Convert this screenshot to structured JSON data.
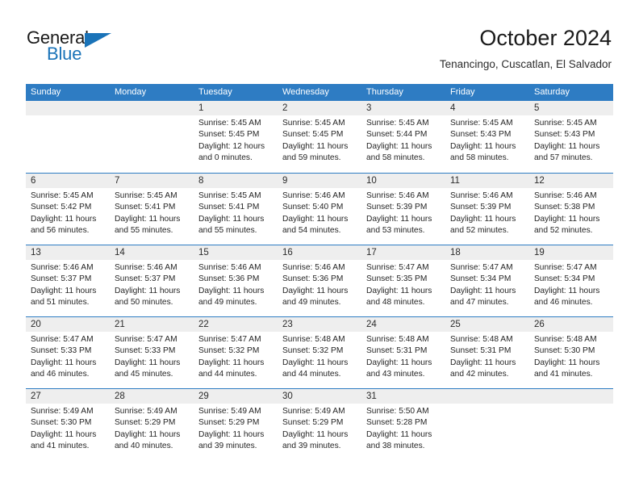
{
  "brand": {
    "word1": "General",
    "word2": "Blue",
    "logo_icon": "triangle-icon"
  },
  "header": {
    "title": "October 2024",
    "subtitle": "Tenancingo, Cuscatlan, El Salvador"
  },
  "colors": {
    "header_blue": "#2e7cc3",
    "brand_blue": "#1a73b8",
    "day_number_bg": "#eeeeee",
    "text": "#252525"
  },
  "weekdays": [
    "Sunday",
    "Monday",
    "Tuesday",
    "Wednesday",
    "Thursday",
    "Friday",
    "Saturday"
  ],
  "weeks": [
    [
      {
        "day": "",
        "empty": true
      },
      {
        "day": "",
        "empty": true
      },
      {
        "day": "1",
        "sunrise": "Sunrise: 5:45 AM",
        "sunset": "Sunset: 5:45 PM",
        "daylight": "Daylight: 12 hours and 0 minutes."
      },
      {
        "day": "2",
        "sunrise": "Sunrise: 5:45 AM",
        "sunset": "Sunset: 5:45 PM",
        "daylight": "Daylight: 11 hours and 59 minutes."
      },
      {
        "day": "3",
        "sunrise": "Sunrise: 5:45 AM",
        "sunset": "Sunset: 5:44 PM",
        "daylight": "Daylight: 11 hours and 58 minutes."
      },
      {
        "day": "4",
        "sunrise": "Sunrise: 5:45 AM",
        "sunset": "Sunset: 5:43 PM",
        "daylight": "Daylight: 11 hours and 58 minutes."
      },
      {
        "day": "5",
        "sunrise": "Sunrise: 5:45 AM",
        "sunset": "Sunset: 5:43 PM",
        "daylight": "Daylight: 11 hours and 57 minutes."
      }
    ],
    [
      {
        "day": "6",
        "sunrise": "Sunrise: 5:45 AM",
        "sunset": "Sunset: 5:42 PM",
        "daylight": "Daylight: 11 hours and 56 minutes."
      },
      {
        "day": "7",
        "sunrise": "Sunrise: 5:45 AM",
        "sunset": "Sunset: 5:41 PM",
        "daylight": "Daylight: 11 hours and 55 minutes."
      },
      {
        "day": "8",
        "sunrise": "Sunrise: 5:45 AM",
        "sunset": "Sunset: 5:41 PM",
        "daylight": "Daylight: 11 hours and 55 minutes."
      },
      {
        "day": "9",
        "sunrise": "Sunrise: 5:46 AM",
        "sunset": "Sunset: 5:40 PM",
        "daylight": "Daylight: 11 hours and 54 minutes."
      },
      {
        "day": "10",
        "sunrise": "Sunrise: 5:46 AM",
        "sunset": "Sunset: 5:39 PM",
        "daylight": "Daylight: 11 hours and 53 minutes."
      },
      {
        "day": "11",
        "sunrise": "Sunrise: 5:46 AM",
        "sunset": "Sunset: 5:39 PM",
        "daylight": "Daylight: 11 hours and 52 minutes."
      },
      {
        "day": "12",
        "sunrise": "Sunrise: 5:46 AM",
        "sunset": "Sunset: 5:38 PM",
        "daylight": "Daylight: 11 hours and 52 minutes."
      }
    ],
    [
      {
        "day": "13",
        "sunrise": "Sunrise: 5:46 AM",
        "sunset": "Sunset: 5:37 PM",
        "daylight": "Daylight: 11 hours and 51 minutes."
      },
      {
        "day": "14",
        "sunrise": "Sunrise: 5:46 AM",
        "sunset": "Sunset: 5:37 PM",
        "daylight": "Daylight: 11 hours and 50 minutes."
      },
      {
        "day": "15",
        "sunrise": "Sunrise: 5:46 AM",
        "sunset": "Sunset: 5:36 PM",
        "daylight": "Daylight: 11 hours and 49 minutes."
      },
      {
        "day": "16",
        "sunrise": "Sunrise: 5:46 AM",
        "sunset": "Sunset: 5:36 PM",
        "daylight": "Daylight: 11 hours and 49 minutes."
      },
      {
        "day": "17",
        "sunrise": "Sunrise: 5:47 AM",
        "sunset": "Sunset: 5:35 PM",
        "daylight": "Daylight: 11 hours and 48 minutes."
      },
      {
        "day": "18",
        "sunrise": "Sunrise: 5:47 AM",
        "sunset": "Sunset: 5:34 PM",
        "daylight": "Daylight: 11 hours and 47 minutes."
      },
      {
        "day": "19",
        "sunrise": "Sunrise: 5:47 AM",
        "sunset": "Sunset: 5:34 PM",
        "daylight": "Daylight: 11 hours and 46 minutes."
      }
    ],
    [
      {
        "day": "20",
        "sunrise": "Sunrise: 5:47 AM",
        "sunset": "Sunset: 5:33 PM",
        "daylight": "Daylight: 11 hours and 46 minutes."
      },
      {
        "day": "21",
        "sunrise": "Sunrise: 5:47 AM",
        "sunset": "Sunset: 5:33 PM",
        "daylight": "Daylight: 11 hours and 45 minutes."
      },
      {
        "day": "22",
        "sunrise": "Sunrise: 5:47 AM",
        "sunset": "Sunset: 5:32 PM",
        "daylight": "Daylight: 11 hours and 44 minutes."
      },
      {
        "day": "23",
        "sunrise": "Sunrise: 5:48 AM",
        "sunset": "Sunset: 5:32 PM",
        "daylight": "Daylight: 11 hours and 44 minutes."
      },
      {
        "day": "24",
        "sunrise": "Sunrise: 5:48 AM",
        "sunset": "Sunset: 5:31 PM",
        "daylight": "Daylight: 11 hours and 43 minutes."
      },
      {
        "day": "25",
        "sunrise": "Sunrise: 5:48 AM",
        "sunset": "Sunset: 5:31 PM",
        "daylight": "Daylight: 11 hours and 42 minutes."
      },
      {
        "day": "26",
        "sunrise": "Sunrise: 5:48 AM",
        "sunset": "Sunset: 5:30 PM",
        "daylight": "Daylight: 11 hours and 41 minutes."
      }
    ],
    [
      {
        "day": "27",
        "sunrise": "Sunrise: 5:49 AM",
        "sunset": "Sunset: 5:30 PM",
        "daylight": "Daylight: 11 hours and 41 minutes."
      },
      {
        "day": "28",
        "sunrise": "Sunrise: 5:49 AM",
        "sunset": "Sunset: 5:29 PM",
        "daylight": "Daylight: 11 hours and 40 minutes."
      },
      {
        "day": "29",
        "sunrise": "Sunrise: 5:49 AM",
        "sunset": "Sunset: 5:29 PM",
        "daylight": "Daylight: 11 hours and 39 minutes."
      },
      {
        "day": "30",
        "sunrise": "Sunrise: 5:49 AM",
        "sunset": "Sunset: 5:29 PM",
        "daylight": "Daylight: 11 hours and 39 minutes."
      },
      {
        "day": "31",
        "sunrise": "Sunrise: 5:50 AM",
        "sunset": "Sunset: 5:28 PM",
        "daylight": "Daylight: 11 hours and 38 minutes."
      },
      {
        "day": "",
        "empty": true
      },
      {
        "day": "",
        "empty": true
      }
    ]
  ]
}
